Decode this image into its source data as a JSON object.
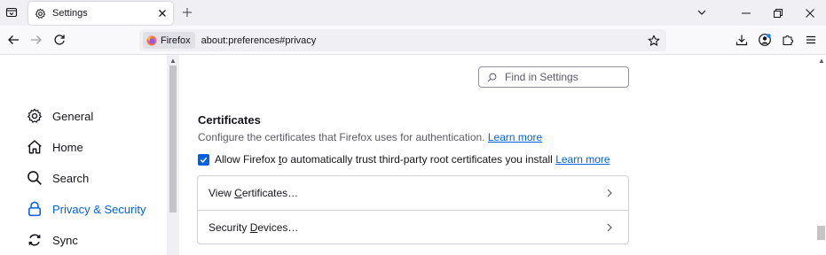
{
  "tabs": [
    {
      "label": "Settings",
      "icon": "gear-icon"
    }
  ],
  "urlbar": {
    "identity_label": "Firefox",
    "url": "about:preferences#privacy"
  },
  "search": {
    "placeholder": "Find in Settings"
  },
  "sidebar": {
    "items": [
      {
        "label": "General",
        "icon": "gear-icon",
        "selected": false
      },
      {
        "label": "Home",
        "icon": "home-icon",
        "selected": false
      },
      {
        "label": "Search",
        "icon": "search-icon",
        "selected": false
      },
      {
        "label": "Privacy & Security",
        "icon": "lock-icon",
        "selected": true
      },
      {
        "label": "Sync",
        "icon": "sync-icon",
        "selected": false
      }
    ]
  },
  "certificates": {
    "title": "Certificates",
    "description": "Configure the certificates that Firefox uses for authentication.",
    "learn_more": "Learn more",
    "checkbox_pre": "Allow Firefox ",
    "checkbox_accel": "t",
    "checkbox_post": "o automatically trust third-party root certificates you install",
    "checkbox_checked": true,
    "view_pre": "View ",
    "view_accel": "C",
    "view_post": "ertificates…",
    "devices_pre": "Security ",
    "devices_accel": "D",
    "devices_post": "evices…"
  },
  "colors": {
    "accent": "#0061e0",
    "tabstrip_bg": "#f0f0f4",
    "text": "#15141a"
  }
}
